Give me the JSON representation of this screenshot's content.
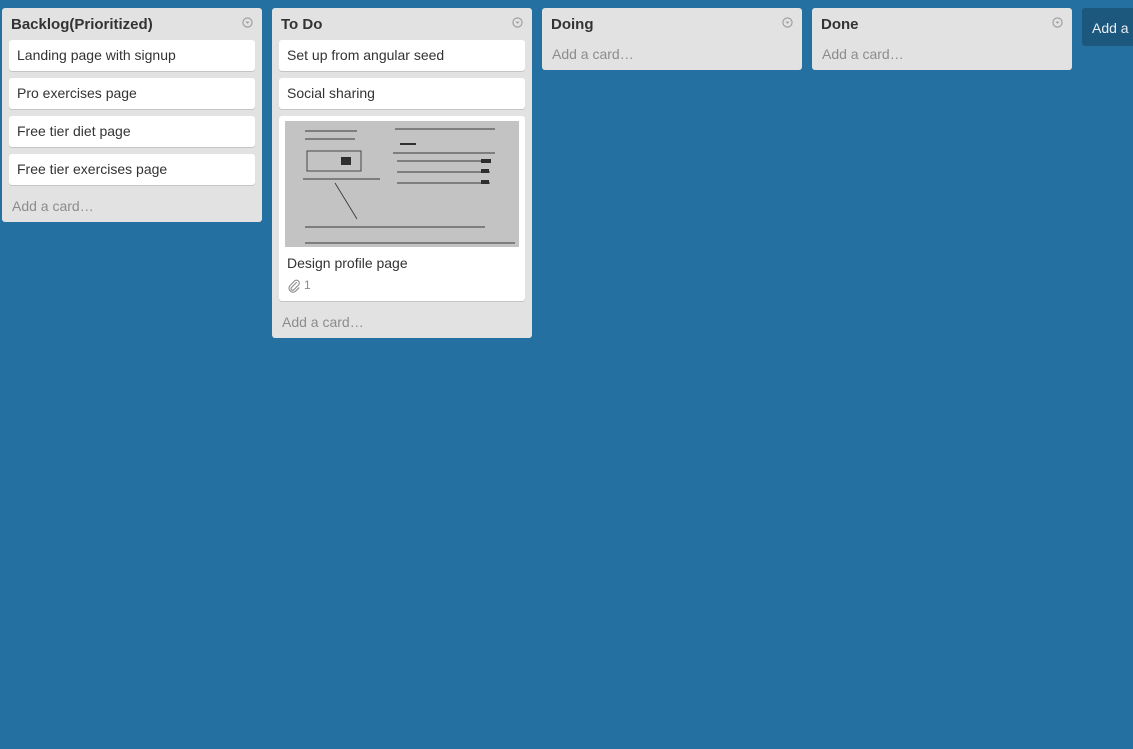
{
  "lists": [
    {
      "title": "Backlog(Prioritized)",
      "cards": [
        {
          "title": "Landing page with signup"
        },
        {
          "title": "Pro exercises page"
        },
        {
          "title": "Free tier diet page"
        },
        {
          "title": "Free tier exercises page"
        }
      ],
      "add_card": "Add a card…"
    },
    {
      "title": "To Do",
      "cards": [
        {
          "title": "Set up from angular seed"
        },
        {
          "title": "Social sharing"
        },
        {
          "title": "Design profile page",
          "attachments": "1"
        }
      ],
      "add_card": "Add a card…"
    },
    {
      "title": "Doing",
      "cards": [],
      "add_card": "Add a card…"
    },
    {
      "title": "Done",
      "cards": [],
      "add_card": "Add a card…"
    }
  ],
  "add_list": "Add a list…",
  "icons": {
    "list_menu": "circle-menu-icon",
    "attachment": "paperclip-icon"
  },
  "colors": {
    "board_background": "#2470a0",
    "list_background": "#e2e2e2",
    "card_background": "#ffffff"
  }
}
